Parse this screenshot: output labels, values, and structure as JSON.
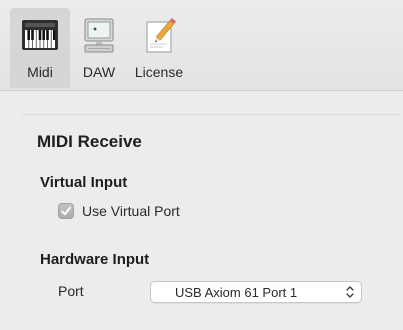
{
  "toolbar": {
    "items": [
      {
        "label": "Midi",
        "icon": "piano-keyboard-icon",
        "selected": true
      },
      {
        "label": "DAW",
        "icon": "desktop-computer-icon",
        "selected": false
      },
      {
        "label": "License",
        "icon": "pencil-document-icon",
        "selected": false
      }
    ]
  },
  "midi_receive": {
    "title": "MIDI Receive",
    "virtual_input": {
      "title": "Virtual Input",
      "use_virtual_port_label": "Use Virtual Port",
      "use_virtual_port_checked": true
    },
    "hardware_input": {
      "title": "Hardware Input",
      "port_label": "Port",
      "port_value": "USB Axiom 61 Port 1"
    }
  },
  "colors": {
    "window_background": "#ececec",
    "selected_tab_background": "#d6d6d6",
    "checkbox_fill": "#b8b8b8"
  }
}
